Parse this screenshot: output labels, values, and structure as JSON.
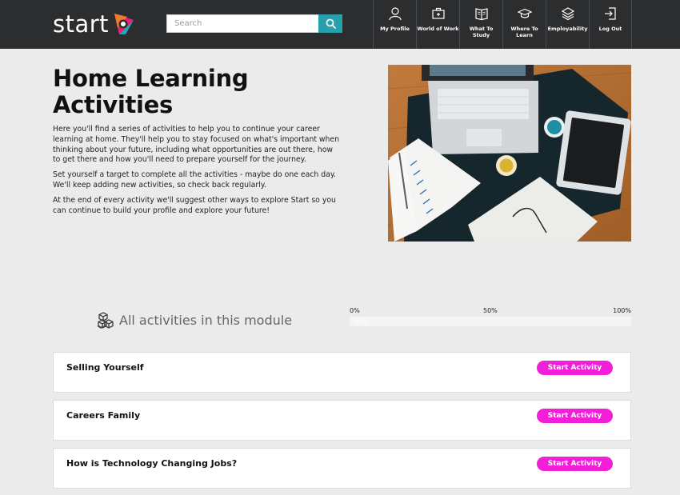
{
  "header": {
    "logo_text": "start",
    "search": {
      "placeholder": "Search",
      "value": ""
    },
    "nav": [
      {
        "label": "My Profile",
        "icon": "user-icon"
      },
      {
        "label": "World of Work",
        "icon": "briefcase-icon"
      },
      {
        "label": "What To Study",
        "icon": "book-icon"
      },
      {
        "label": "Where To Learn",
        "icon": "graduation-cap-icon"
      },
      {
        "label": "Employability",
        "icon": "layers-icon"
      },
      {
        "label": "Log Out",
        "icon": "logout-icon"
      }
    ]
  },
  "hero": {
    "title": "Home Learning Activities",
    "paragraphs": [
      "Here you'll find a series of activities to help you to continue your career learning at home. They'll help you to stay focused on what's important when thinking about your future, including what opportunities are out there, how to get there and how you'll need to prepare yourself for the journey.",
      "Set yourself a target to complete all the activities - maybe do one each day. We'll keep adding new activities, so check back regularly.",
      "At the end of every activity we'll suggest other ways to explore Start so you can continue to build your profile and explore your future!"
    ]
  },
  "module": {
    "title": "All activities in this module",
    "progress": {
      "label_start": "0%",
      "label_mid": "50%",
      "label_end": "100%",
      "percent_text": "0 %",
      "value": 0
    }
  },
  "activities": [
    {
      "title": "Selling Yourself",
      "button": "Start Activity"
    },
    {
      "title": "Careers Family",
      "button": "Start Activity"
    },
    {
      "title": "How is Technology Changing Jobs?",
      "button": "Start Activity"
    }
  ],
  "colors": {
    "header_bg": "#2c2d2f",
    "accent_teal": "#24a1ad",
    "button_magenta": "#f21fd8",
    "page_bg": "#ebebeb"
  }
}
